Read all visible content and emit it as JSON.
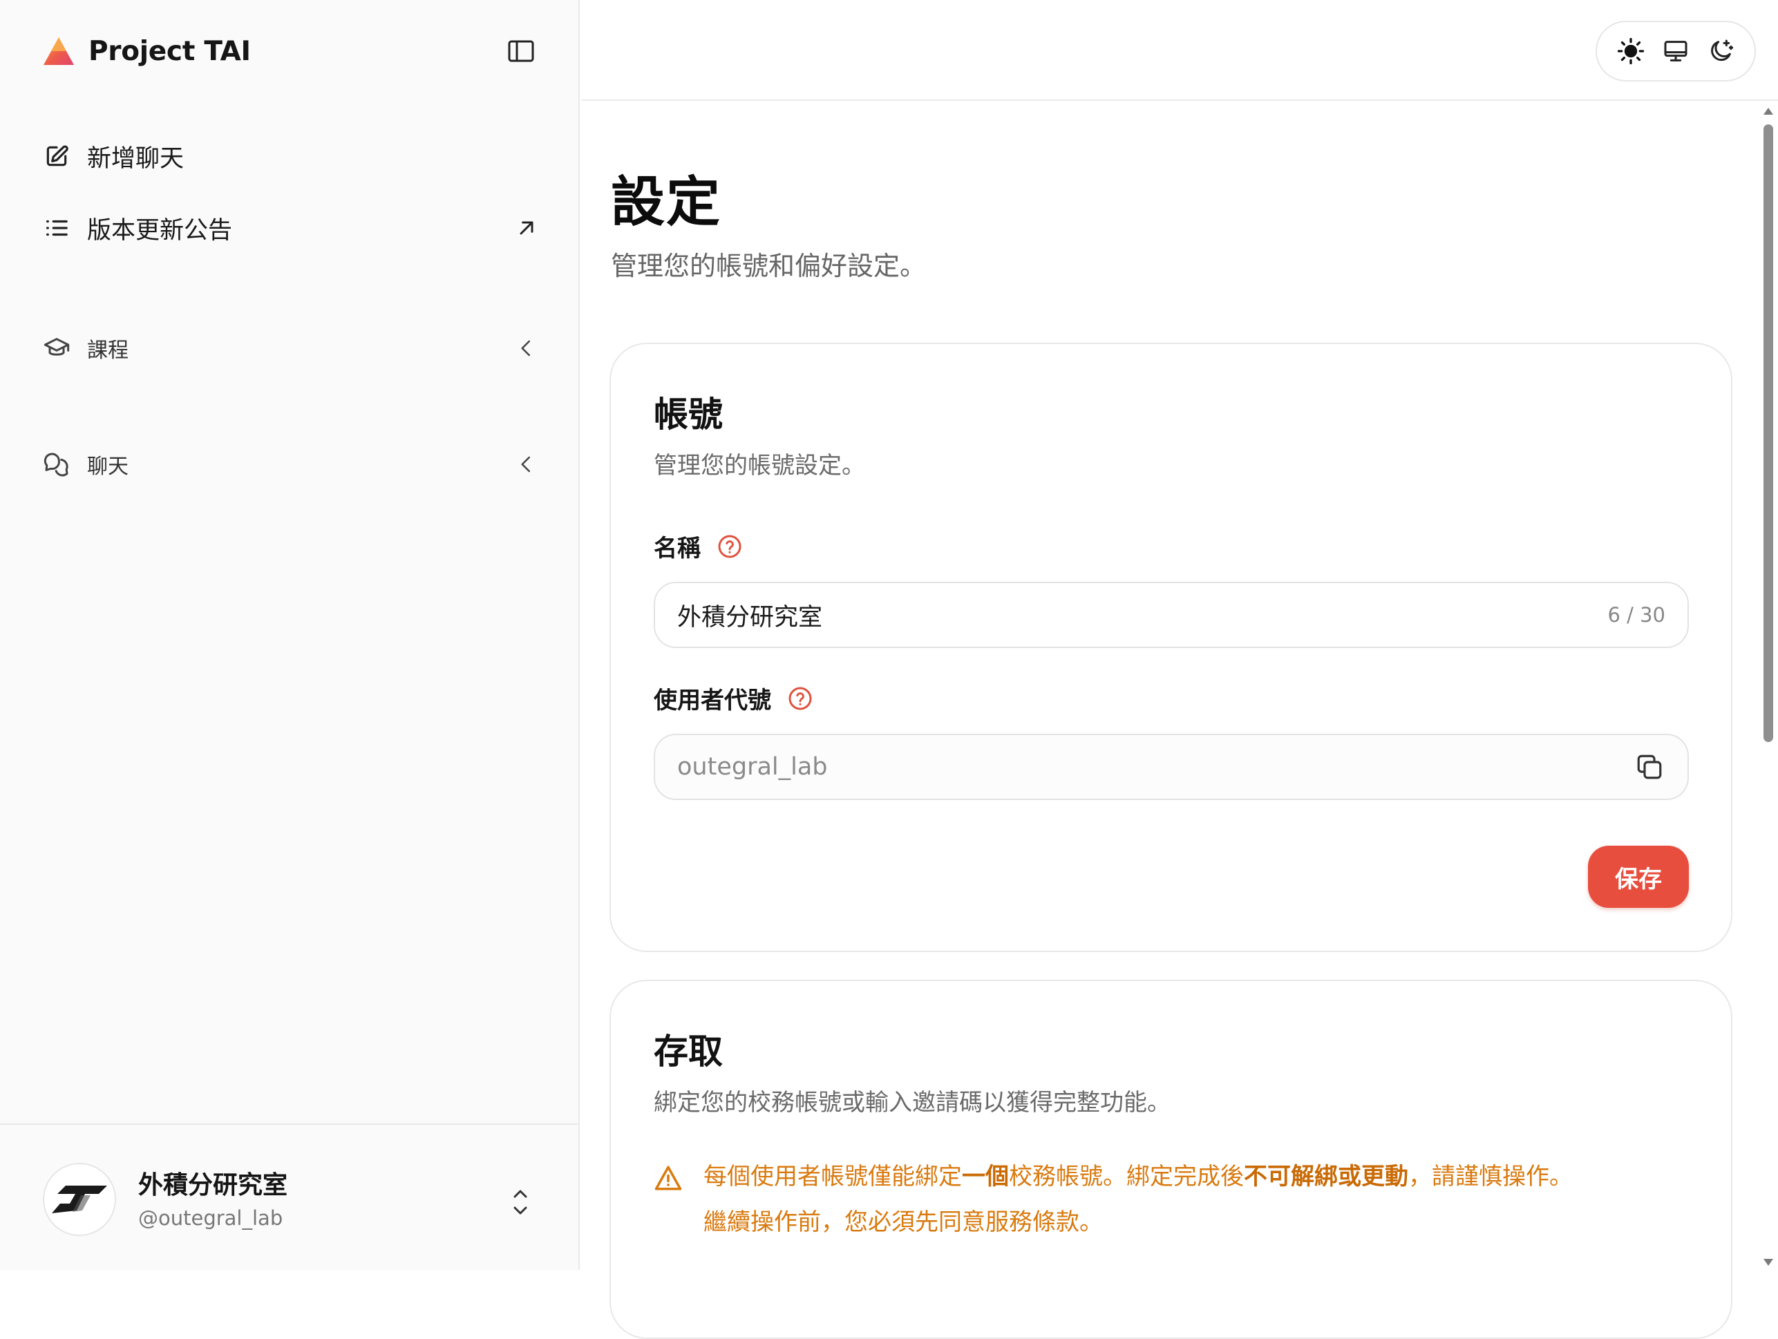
{
  "app": {
    "title": "Project TAI"
  },
  "sidebar": {
    "new_chat_label": "新增聊天",
    "changelog_label": "版本更新公告",
    "courses_label": "課程",
    "chats_label": "聊天"
  },
  "user": {
    "name": "外積分研究室",
    "handle": "@outegral_lab"
  },
  "theme_switch": {
    "options": [
      "light-icon",
      "system-icon",
      "dark-icon"
    ]
  },
  "page": {
    "title": "設定",
    "subtitle": "管理您的帳號和偏好設定。"
  },
  "account_card": {
    "title": "帳號",
    "subtitle": "管理您的帳號設定。",
    "name_label": "名稱",
    "name_value": "外積分研究室",
    "name_count": "6 / 30",
    "username_label": "使用者代號",
    "username_value": "outegral_lab",
    "save_label": "保存"
  },
  "access_card": {
    "title": "存取",
    "subtitle": "綁定您的校務帳號或輸入邀請碼以獲得完整功能。",
    "warning": {
      "part1": "每個使用者帳號僅能綁定",
      "bold1": "一個",
      "part2": "校務帳號。綁定完成後",
      "bold2": "不可解綁或更動",
      "part3": "，請謹慎操作。",
      "line2": "繼續操作前，您必須先同意服務條款。"
    }
  },
  "colors": {
    "accent": "#e84e3e",
    "warning": "#d97a0f",
    "sidebar_bg": "#fafafa"
  }
}
